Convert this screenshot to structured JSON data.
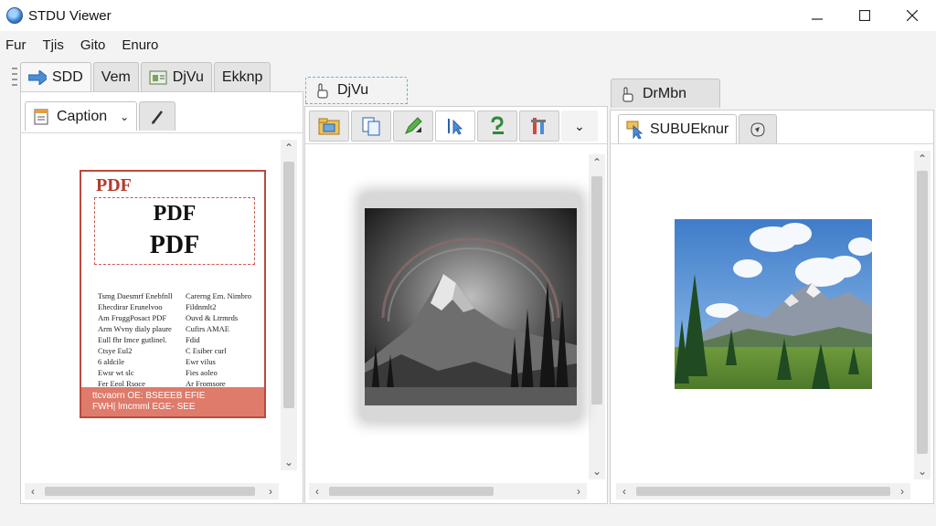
{
  "window": {
    "title": "STDU Viewer"
  },
  "menu": [
    "Fur",
    "Tjis",
    "Gito",
    "Enuro"
  ],
  "left_panel": {
    "tabs": [
      {
        "label": "SDD",
        "icon": "arrow-right-icon"
      },
      {
        "label": "Vem",
        "icon": ""
      },
      {
        "label": "DjVu",
        "icon": "document-viewer-icon"
      },
      {
        "label": "Ekknp",
        "icon": ""
      }
    ],
    "subtab": {
      "label": "Caption",
      "icon": "document-edit-icon"
    },
    "pdf_page": {
      "header_small": "PDF",
      "heading1": "PDF",
      "heading2": "PDF",
      "body_col1": [
        "Tsmg Daesmrf Enebfnll",
        "Ehecdirar Erunelvoo",
        "Am FruggPosact PDF",
        "Arm Wvny dialy plaure",
        "Eull fhr Imce gutlinel.",
        "Ctsye Eul2",
        "6 aldcile",
        "Ewsr wt slc",
        "Fer Eeol Rsoce"
      ],
      "body_col2": [
        "Carerng Em. Nimbro",
        "Fildnmlt2",
        "Ouvd & Ltrmrds",
        "Cufirs AMAE",
        "Fdid",
        "C Esiber curl",
        "Ewr vilus",
        "Fies aoleo",
        "Ar Fromsore"
      ],
      "footer_line1": "ttcvaorn OE: BSEEEB EFIE",
      "footer_line2": "FWH| lmcmml EGE- SEE"
    }
  },
  "middle_panel": {
    "tab": {
      "label": "DjVu",
      "icon": "hand-icon"
    },
    "toolbar": [
      {
        "name": "open-folder-icon"
      },
      {
        "name": "copy-pages-icon"
      },
      {
        "name": "edit-arrow-icon"
      },
      {
        "name": "select-cursor-icon"
      },
      {
        "name": "help-icon"
      },
      {
        "name": "tools-icon"
      },
      {
        "name": "chevron-down-icon"
      }
    ]
  },
  "right_panel": {
    "tab": {
      "label": "DrMbn",
      "icon": "hand-icon"
    },
    "subtabs": [
      {
        "label": "SUBUEknur",
        "icon": "cursor-select-icon"
      },
      {
        "label": "",
        "icon": "shape-icon"
      }
    ]
  },
  "colors": {
    "accent": "#3f7fc9",
    "pdf_red": "#b84a3e",
    "footer_red": "#de7b6b"
  }
}
